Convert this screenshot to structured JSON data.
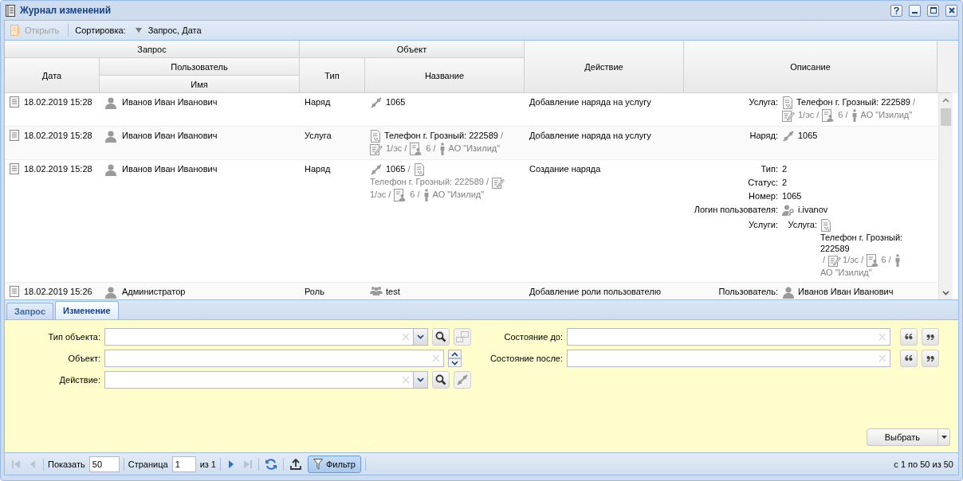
{
  "window": {
    "title": "Журнал изменений"
  },
  "toolbar": {
    "open_button": {
      "label": "Открыть",
      "disabled": true
    },
    "sort_label": "Сортировка:",
    "sort_value": "Запрос, Дата"
  },
  "table": {
    "column_groups": [
      "Запрос",
      "Объект"
    ],
    "subgroup": "Пользователь",
    "columns": [
      "Дата",
      "Имя",
      "Тип",
      "Название",
      "Действие",
      "Описание"
    ],
    "rows": [
      {
        "date": "18.02.2019 15:28",
        "user": "Иванов Иван Иванович",
        "type": "Наряд",
        "name": [
          {
            "kind": "order",
            "text": "1065",
            "muted": false
          }
        ],
        "action": "Добавление наряда на услугу",
        "description": [
          {
            "label": "Услуга:",
            "parts": [
              {
                "kind": "service",
                "text": "Телефон г. Грозный: 222589",
                "sep": "/",
                "muted": false
              },
              {
                "kind": "contract",
                "text": "1/эс",
                "sep": "/",
                "muted": true
              },
              {
                "kind": "account",
                "text": "6",
                "sep": "/",
                "muted": true
              },
              {
                "kind": "client",
                "text": "АО \"Изилид\"",
                "muted": true
              }
            ]
          }
        ]
      },
      {
        "date": "18.02.2019 15:28",
        "user": "Иванов Иван Иванович",
        "type": "Услуга",
        "name": [
          {
            "kind": "service",
            "text": "Телефон г. Грозный: 222589",
            "sep": "/",
            "muted": false
          },
          {
            "kind": "contract",
            "text": "1/эс",
            "sep": "/",
            "muted": true
          },
          {
            "kind": "account",
            "text": "6",
            "sep": "/",
            "muted": true
          },
          {
            "kind": "client",
            "text": "АО \"Изилид\"",
            "muted": true
          }
        ],
        "action": "Добавление наряда на услугу",
        "description": [
          {
            "label": "Наряд:",
            "parts": [
              {
                "kind": "order",
                "text": "1065",
                "muted": false
              }
            ]
          }
        ]
      },
      {
        "date": "18.02.2019 15:28",
        "user": "Иванов Иван Иванович",
        "type": "Наряд",
        "name": [
          {
            "kind": "order",
            "text": "1065",
            "sep": "/",
            "muted": false
          },
          {
            "kind": "service",
            "text": "Телефон г. Грозный: 222589",
            "sep": "/",
            "muted": true
          },
          {
            "kind": "contract",
            "text": "1/эс",
            "sep": "/",
            "muted": true
          },
          {
            "kind": "account",
            "text": "6",
            "sep": "/",
            "muted": true
          },
          {
            "kind": "client",
            "text": "АО \"Изилид\"",
            "muted": true
          }
        ],
        "action": "Создание наряда",
        "description": [
          {
            "label": "Тип:",
            "value": "2"
          },
          {
            "label": "Статус:",
            "value": "2"
          },
          {
            "label": "Номер:",
            "value": "1065"
          },
          {
            "label": "Логин пользователя:",
            "parts": [
              {
                "kind": "login",
                "text": "i.ivanov",
                "muted": false
              }
            ]
          },
          {
            "label": "Услуги:",
            "children": [
              {
                "label": "Услуга:",
                "parts": [
                  {
                    "kind": "service",
                    "text": "Телефон г. Грозный: 222589",
                    "sep": "/",
                    "muted": false
                  },
                  {
                    "kind": "contract",
                    "text": "1/эс",
                    "sep": "/",
                    "muted": true
                  },
                  {
                    "kind": "account",
                    "text": "6",
                    "sep": "/",
                    "muted": true
                  },
                  {
                    "kind": "client",
                    "text": "АО \"Изилид\"",
                    "muted": true
                  }
                ]
              }
            ]
          }
        ]
      },
      {
        "date": "18.02.2019 15:26",
        "user": "Администратор",
        "type": "Роль",
        "name": [
          {
            "kind": "role",
            "text": "test",
            "muted": false
          }
        ],
        "action": "Добавление роли пользователю",
        "description": [
          {
            "label": "Пользователь:",
            "parts": [
              {
                "kind": "user",
                "text": "Иванов Иван Иванович",
                "muted": false
              }
            ]
          }
        ]
      }
    ]
  },
  "tabs": [
    {
      "label": "Запрос",
      "selected": false
    },
    {
      "label": "Изменение",
      "selected": true
    }
  ],
  "filter": {
    "left": [
      {
        "label": "Тип объекта:",
        "kind": "combo"
      },
      {
        "label": "Объект:",
        "kind": "spinner"
      },
      {
        "label": "Действие:",
        "kind": "combo"
      }
    ],
    "right": [
      {
        "label": "Состояние до:",
        "kind": "quote"
      },
      {
        "label": "Состояние после:",
        "kind": "quote"
      }
    ]
  },
  "select_button": "Выбрать",
  "paging": {
    "show_label": "Показать",
    "page_size": "50",
    "page_label": "Страница",
    "page": "1",
    "page_count": "из 1",
    "filter_button": {
      "label": "Фильтр",
      "pressed": true
    },
    "summary": "с 1 по 50 из 50"
  }
}
